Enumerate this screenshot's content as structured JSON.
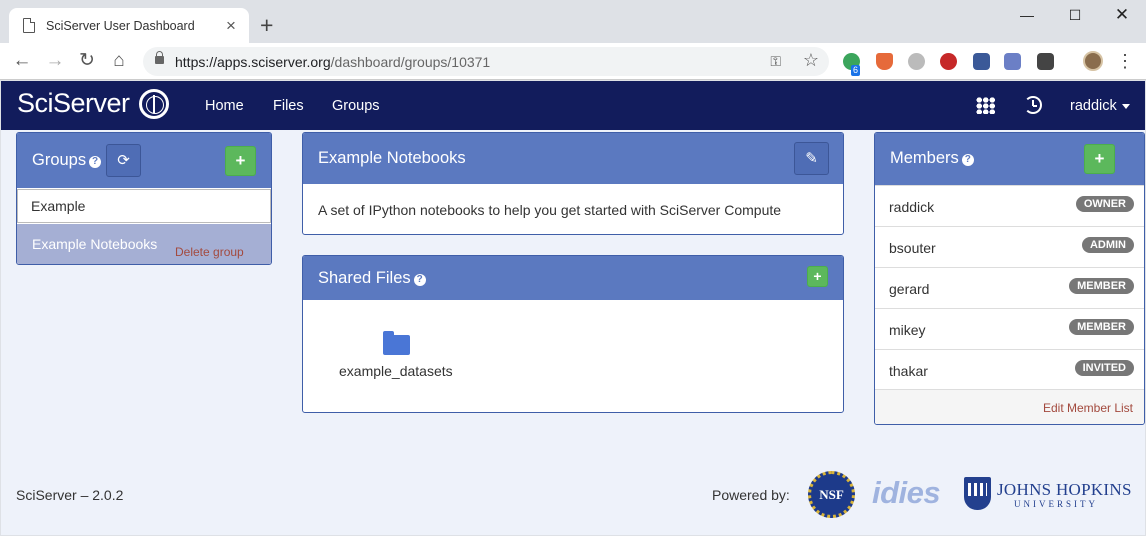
{
  "browser": {
    "tab_title": "SciServer User Dashboard",
    "url_host": "https://apps.sciserver.org",
    "url_path": "/dashboard/groups/10371",
    "extension_badge": "6"
  },
  "navbar": {
    "brand": "SciServer",
    "links": [
      "Home",
      "Files",
      "Groups"
    ],
    "username": "raddick"
  },
  "groups_panel": {
    "title": "Groups",
    "search_value": "Example",
    "selected_group": "Example Notebooks",
    "delete_label": "Delete group"
  },
  "notebook_panel": {
    "title": "Example Notebooks",
    "description": "A set of IPython notebooks to help you get started with SciServer Compute"
  },
  "shared_files": {
    "title": "Shared Files",
    "folder_name": "example_datasets"
  },
  "members_panel": {
    "title": "Members",
    "members": [
      {
        "name": "raddick",
        "role": "OWNER"
      },
      {
        "name": "bsouter",
        "role": "ADMIN"
      },
      {
        "name": "gerard",
        "role": "MEMBER"
      },
      {
        "name": "mikey",
        "role": "MEMBER"
      },
      {
        "name": "thakar",
        "role": "INVITED"
      }
    ],
    "edit_label": "Edit Member List"
  },
  "footer": {
    "version": "SciServer – 2.0.2",
    "powered_by": "Powered by:",
    "logo_nsf": "NSF",
    "logo_idies": "idies",
    "logo_jhu": "JOHNS HOPKINS",
    "logo_jhu_sub": "UNIVERSITY"
  },
  "colors": {
    "navbar": "#121c5c",
    "panel_header": "#5b79c0",
    "add_button": "#5cb85c",
    "selected_group": "#a5afd4",
    "link_red": "#a34a3e"
  }
}
